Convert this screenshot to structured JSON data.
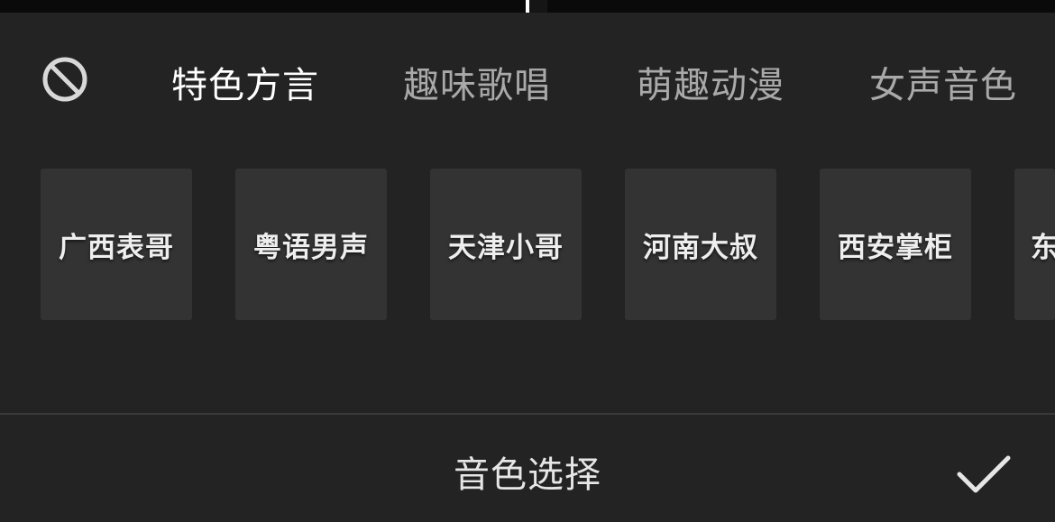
{
  "tabs": [
    {
      "label": "特色方言",
      "active": true
    },
    {
      "label": "趣味歌唱",
      "active": false
    },
    {
      "label": "萌趣动漫",
      "active": false
    },
    {
      "label": "女声音色",
      "active": false
    }
  ],
  "voices": [
    "广西表哥",
    "粤语男声",
    "天津小哥",
    "河南大叔",
    "西安掌柜",
    "东"
  ],
  "footer": {
    "title": "音色选择"
  },
  "icons": {
    "none": "no-effect-icon",
    "confirm": "checkmark-icon"
  },
  "colors": {
    "background": "#232323",
    "card": "#333333",
    "active_text": "#ffffff",
    "inactive_text": "#a9a9a9"
  }
}
